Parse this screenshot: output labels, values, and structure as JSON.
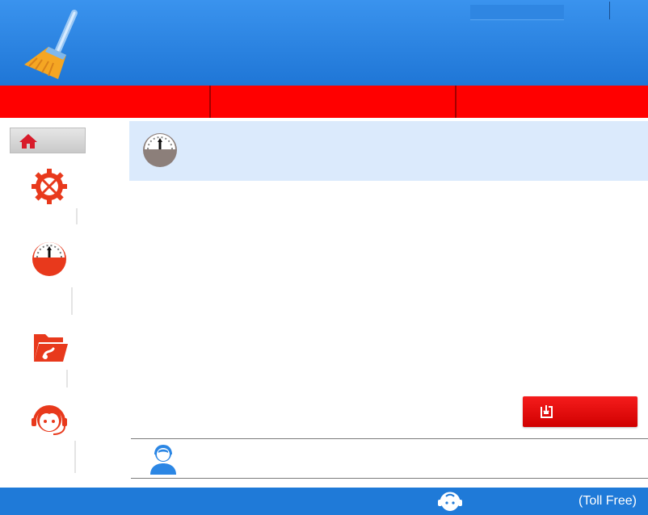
{
  "header": {
    "logo_icon": "broom-icon",
    "account_label": ""
  },
  "tabs": [
    {
      "label": ""
    },
    {
      "label": ""
    },
    {
      "label": ""
    }
  ],
  "sidebar": {
    "home": {
      "icon": "home-icon",
      "label": ""
    },
    "items": [
      {
        "icon": "gear-tools-icon",
        "label": ""
      },
      {
        "icon": "speedometer-icon",
        "label": ""
      },
      {
        "icon": "folder-repair-icon",
        "label": ""
      },
      {
        "icon": "support-agent-icon",
        "label": ""
      }
    ]
  },
  "banner": {
    "icon": "speedometer-icon",
    "title": "",
    "subtitle": ""
  },
  "action_button": {
    "icon": "import-icon",
    "label": ""
  },
  "support": {
    "icon": "support-person-icon",
    "text": ""
  },
  "footer": {
    "icon": "headset-icon",
    "phone": "",
    "toll_free": "(Toll Free)"
  },
  "colors": {
    "header_blue": "#2a86e6",
    "tab_red": "#ff0000",
    "icon_red": "#e8391c",
    "banner_bg": "#dbeafc",
    "footer_blue": "#1f7ad8"
  }
}
